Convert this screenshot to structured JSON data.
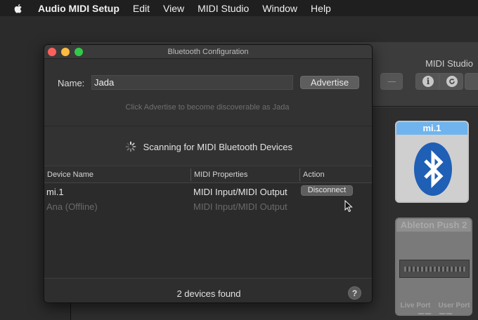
{
  "menubar": {
    "app_name": "Audio MIDI Setup",
    "items": [
      "Edit",
      "View",
      "MIDI Studio",
      "Window",
      "Help"
    ]
  },
  "background_window": {
    "title": "MIDI Studio",
    "toolbar_icons": [
      "minus-icon",
      "info-icon",
      "refresh-icon"
    ],
    "devices": [
      {
        "name": "mi.1",
        "icon": "bluetooth-icon",
        "header_color": "#6fb4ee"
      },
      {
        "name": "Ableton Push 2",
        "ports": [
          "Live Port",
          "User Port"
        ]
      }
    ]
  },
  "dialog": {
    "title": "Bluetooth Configuration",
    "name_label": "Name:",
    "name_value": "Jada",
    "advertise_button": "Advertise",
    "hint": "Click Advertise to become discoverable as Jada",
    "scanning_text": "Scanning for MIDI Bluetooth Devices",
    "columns": [
      "Device Name",
      "MIDI Properties",
      "Action"
    ],
    "rows": [
      {
        "name": "mi.1",
        "properties": "MIDI Input/MIDI Output",
        "action": "Disconnect"
      },
      {
        "name": "Ana (Offline)",
        "properties": "MIDI Input/MIDI Output",
        "action": ""
      }
    ],
    "footer_text": "2 devices found",
    "help_label": "?"
  },
  "colors": {
    "close": "#fc605c",
    "minimize": "#fdbc40",
    "zoom": "#34c84a",
    "bluetooth_blue": "#1f5fb5"
  }
}
